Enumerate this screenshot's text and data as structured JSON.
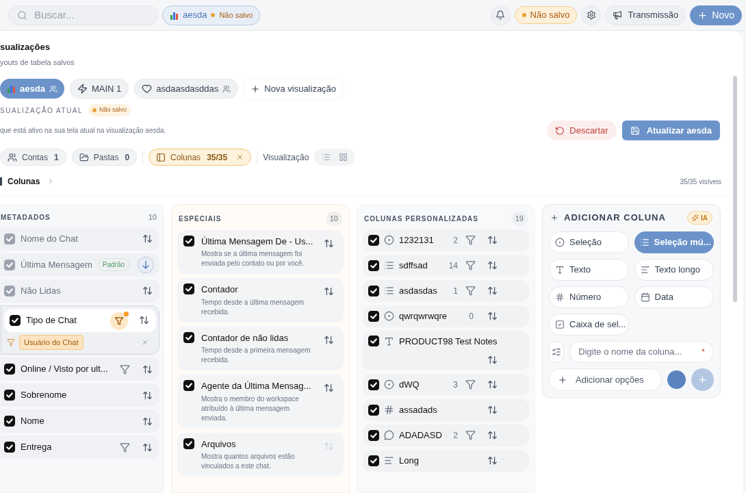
{
  "topbar": {
    "search": {
      "placeholder": "Buscar..."
    },
    "current_view": {
      "label": "aesda",
      "status": "Não salvo"
    },
    "unsaved_badge": "Não salvo",
    "broadcast": "Transmissão",
    "new": "Novo"
  },
  "header": {
    "title": "sualizações",
    "subtitle": "youts de tabela salvos"
  },
  "views": [
    {
      "label": "aesda",
      "kind": "chart",
      "shared": true,
      "selected": true
    },
    {
      "label": "MAIN 1",
      "kind": "bolt",
      "shared": false,
      "selected": false
    },
    {
      "label": "asdaasdasddas",
      "kind": "heart",
      "shared": true,
      "selected": false
    }
  ],
  "new_view": "Nova visualização",
  "current": {
    "label": "SUALIZAÇÃO ATUAL",
    "status": "Não salvo",
    "description": "que está ativo na sua tela atual na visualização aesda.",
    "discard": "Descartar",
    "update": "Atualizar aesda"
  },
  "filters": [
    {
      "kind": "accounts",
      "label": "Contas",
      "count": "1",
      "selected": false
    },
    {
      "kind": "folders",
      "label": "Pastas",
      "count": "0",
      "selected": false
    },
    {
      "kind": "columns",
      "label": "Colunas",
      "count": "35/35",
      "selected": true
    }
  ],
  "view_mode": {
    "label": "Visualização",
    "modes": [
      {
        "kind": "list",
        "selected": false
      },
      {
        "kind": "grid",
        "selected": false
      }
    ]
  },
  "breadcrumb": "Colunas",
  "visible_count": "35/35 visíveis",
  "metadados": {
    "title": "METADADOS",
    "count": "10",
    "items": [
      {
        "label": "Nome do Chat",
        "checked": true,
        "disabled": true,
        "sorted_desc": false,
        "filterable": false,
        "filter_active": false
      },
      {
        "label": "Última Mensagem",
        "checked": true,
        "disabled": true,
        "badge": "Padrão",
        "sorted_desc": true,
        "filterable": false,
        "filter_active": false
      },
      {
        "label": "Não Lidas",
        "checked": true,
        "disabled": true,
        "sorted_desc": false,
        "filterable": false,
        "filter_active": false
      },
      {
        "label": "Tipo de Chat",
        "checked": true,
        "disabled": false,
        "sorted_desc": false,
        "filterable": true,
        "filter_active": true,
        "filter_value": "Usuário do Chat"
      },
      {
        "label": "Online / Visto por ult...",
        "checked": true,
        "disabled": false,
        "sorted_desc": false,
        "filterable": true,
        "filter_active": false
      },
      {
        "label": "Sobrenome",
        "checked": true,
        "disabled": false,
        "sorted_desc": false,
        "filterable": false,
        "filter_active": false
      },
      {
        "label": "Nome",
        "checked": true,
        "disabled": false,
        "sorted_desc": false,
        "filterable": false,
        "filter_active": false
      },
      {
        "label": "Entrega",
        "checked": true,
        "disabled": false,
        "sorted_desc": false,
        "filterable": true,
        "filter_active": false
      }
    ]
  },
  "especiais": {
    "title": "ESPECIAIS",
    "count": "10",
    "items": [
      {
        "label": "Última Mensagem De - Us...",
        "description": "Mostra se a última mensagem foi enviada pelo contato ou por você.",
        "checked": true,
        "disabled": false
      },
      {
        "label": "Contador",
        "description": "Tempo desde a última mensagem recebida.",
        "checked": true,
        "disabled": false
      },
      {
        "label": "Contador de não lidas",
        "description": "Tempo desde a primeira mensagem recebida.",
        "checked": true,
        "disabled": false
      },
      {
        "label": "Agente da Última Mensag...",
        "description": "Mostra o membro do workspace atribuído à última mensagem enviada.",
        "checked": true,
        "disabled": false
      },
      {
        "label": "Arquivos",
        "description": "Mostra quantos arquivos estão vinculados a este chat.",
        "checked": true,
        "disabled": true
      }
    ]
  },
  "personalizadas": {
    "title": "COLUNAS PERSONALIZADAS",
    "count": "19",
    "items": [
      {
        "kind": "select",
        "label": "1232131",
        "count": "2",
        "filterable": true,
        "checked": true
      },
      {
        "kind": "multi",
        "label": "sdffsad",
        "count": "14",
        "filterable": true,
        "checked": true
      },
      {
        "kind": "multi",
        "label": "asdasdas",
        "count": "1",
        "filterable": true,
        "checked": true
      },
      {
        "kind": "select",
        "label": "qwrqwrwqre",
        "count": "0",
        "filterable": false,
        "checked": true
      },
      {
        "kind": "text",
        "label": "PRODUCT98 Test Notes",
        "filterable": false,
        "checked": true
      },
      {
        "kind": "select",
        "label": "dWQ",
        "count": "3",
        "filterable": true,
        "checked": true
      },
      {
        "kind": "number",
        "label": "assadads",
        "filterable": false,
        "checked": true
      },
      {
        "kind": "comment",
        "label": "ADADASD",
        "count": "2",
        "filterable": true,
        "checked": true
      },
      {
        "kind": "long",
        "label": "Long",
        "filterable": false,
        "checked": true
      }
    ]
  },
  "add_column": {
    "title": "ADICIONAR COLUNA",
    "ai": "IA",
    "types": [
      {
        "kind": "select",
        "label": "Seleção",
        "selected": false
      },
      {
        "kind": "multi",
        "label": "Seleção mú...",
        "selected": true
      },
      {
        "kind": "text",
        "label": "Texto",
        "selected": false
      },
      {
        "kind": "long",
        "label": "Texto longo",
        "selected": false
      },
      {
        "kind": "number",
        "label": "Número",
        "selected": false
      },
      {
        "kind": "date",
        "label": "Data",
        "selected": false
      },
      {
        "kind": "checkbox",
        "label": "Caixa de sel...",
        "selected": false
      }
    ],
    "name_placeholder": "Digite o nome da coluna...",
    "required_mark": "*",
    "add_options": "Adicionar opções",
    "color": "#5b84bf"
  }
}
